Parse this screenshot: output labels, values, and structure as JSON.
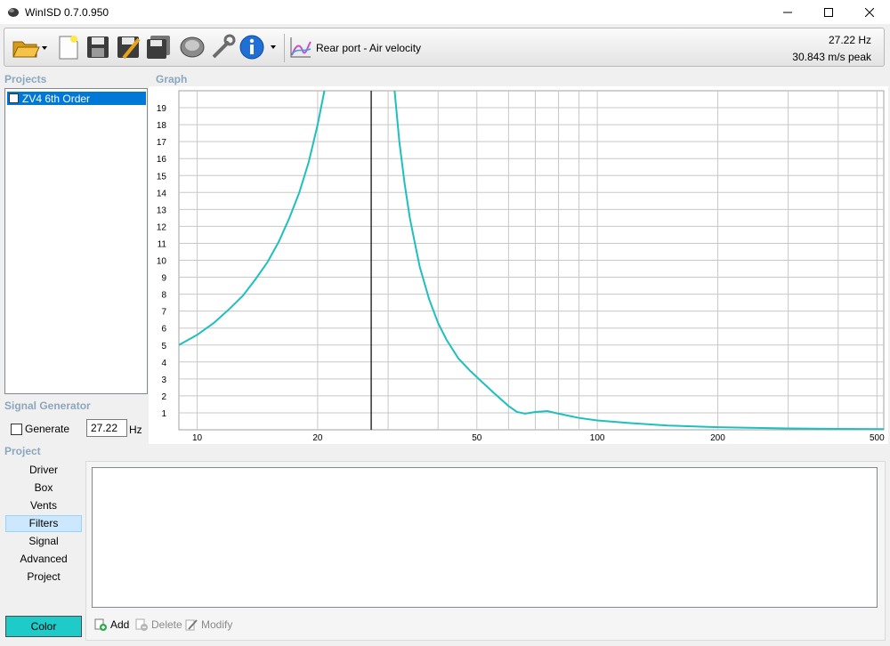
{
  "window": {
    "title": "WinISD 0.7.0.950"
  },
  "toolbar": {
    "graph_select_label": "Rear port - Air velocity",
    "readout_frequency": "27.22 Hz",
    "readout_peak": "30.843 m/s peak",
    "icons": [
      "open-folder-icon",
      "new-project-icon",
      "save-icon",
      "save-as-icon",
      "save-all-icon",
      "driver-icon",
      "tools-icon",
      "info-icon",
      "graph-icon"
    ]
  },
  "projects": {
    "header": "Projects",
    "items": [
      {
        "label": "ZV4 6th Order",
        "checked": true
      }
    ]
  },
  "graph": {
    "header": "Graph"
  },
  "signal_generator": {
    "header": "Signal Generator",
    "generate_label": "Generate",
    "generate_checked": false,
    "frequency_value": "27.22",
    "unit": "Hz"
  },
  "project_nav": {
    "header": "Project",
    "items": [
      "Driver",
      "Box",
      "Vents",
      "Filters",
      "Signal",
      "Advanced",
      "Project"
    ],
    "selected": "Filters",
    "color_button": "Color"
  },
  "actions": {
    "add": "Add",
    "delete": "Delete",
    "modify": "Modify"
  },
  "colors": {
    "curve": "#1ebfbf",
    "color_swatch": "#1ecbc8",
    "selection": "#0078d7",
    "section_header": "#8da6bf"
  },
  "chart_data": {
    "type": "line",
    "title": "",
    "xlabel": "",
    "ylabel": "",
    "x_scale": "log",
    "xlim": [
      9,
      520
    ],
    "ylim": [
      0,
      20
    ],
    "x_tick_labels": [
      "10",
      "20",
      "50",
      "100",
      "200",
      "500"
    ],
    "y_tick_labels": [
      "1",
      "2",
      "3",
      "4",
      "5",
      "6",
      "7",
      "8",
      "9",
      "10",
      "11",
      "12",
      "13",
      "14",
      "15",
      "16",
      "17",
      "18",
      "19"
    ],
    "grid": true,
    "marker_x": 27.22,
    "series": [
      {
        "name": "",
        "x": [
          9,
          10,
          11,
          12,
          13,
          14,
          15,
          16,
          17,
          18,
          19,
          20,
          21,
          22,
          23,
          24,
          30,
          31,
          32,
          33,
          34,
          35,
          36,
          38,
          40,
          42,
          45,
          48,
          50,
          55,
          60,
          63,
          66,
          70,
          75,
          80,
          90,
          100,
          120,
          150,
          200,
          300,
          400,
          520
        ],
        "y": [
          5.0,
          5.6,
          6.3,
          7.1,
          7.9,
          8.9,
          9.9,
          11.1,
          12.5,
          14.0,
          15.8,
          18.0,
          20.5,
          23.5,
          27.0,
          30.8,
          26.0,
          20.5,
          17.0,
          14.5,
          12.5,
          11.0,
          9.6,
          7.7,
          6.3,
          5.3,
          4.2,
          3.5,
          3.1,
          2.2,
          1.4,
          1.05,
          0.95,
          1.05,
          1.1,
          0.95,
          0.7,
          0.55,
          0.4,
          0.25,
          0.15,
          0.08,
          0.05,
          0.04
        ]
      }
    ]
  }
}
